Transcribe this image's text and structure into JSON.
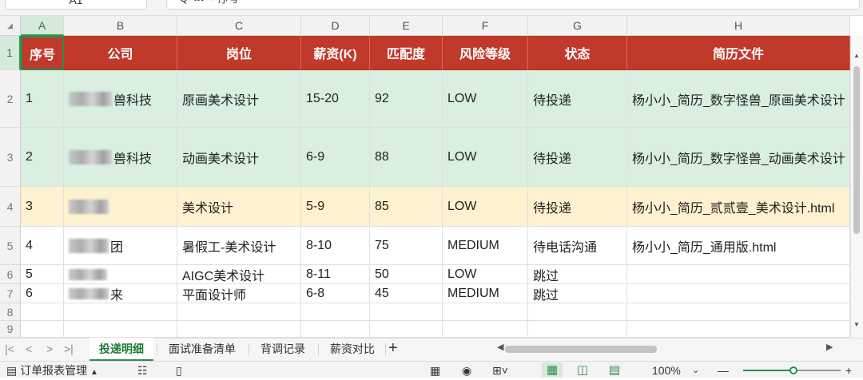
{
  "formula_bar": {
    "name_box": "A1",
    "zoom_icon": "Q",
    "fx_label": "fx",
    "value": "序号",
    "expand_icon": "chevron-down-icon"
  },
  "columns": [
    "A",
    "B",
    "C",
    "D",
    "E",
    "F",
    "G",
    "H"
  ],
  "header_row": {
    "row_number": "1",
    "cells": [
      "序号",
      "公司",
      "岗位",
      "薪资(K)",
      "匹配度",
      "风险等级",
      "状态",
      "简历文件"
    ]
  },
  "rows": [
    {
      "row_number": "2",
      "id": "1",
      "company_suffix": "兽科技",
      "position": "原画美术设计",
      "salary": "15-20",
      "match": "92",
      "risk": "LOW",
      "status": "待投递",
      "resume": "杨小小_简历_数字怪兽_原画美术设计"
    },
    {
      "row_number": "3",
      "id": "2",
      "company_suffix": "兽科技",
      "position": "动画美术设计",
      "salary": "6-9",
      "match": "88",
      "risk": "LOW",
      "status": "待投递",
      "resume": "杨小小_简历_数字怪兽_动画美术设计"
    },
    {
      "row_number": "4",
      "id": "3",
      "company_suffix": "",
      "position": "美术设计",
      "salary": "5-9",
      "match": "85",
      "risk": "LOW",
      "status": "待投递",
      "resume": "杨小小_简历_贰贰壹_美术设计.html"
    },
    {
      "row_number": "5",
      "id": "4",
      "company_suffix": "团",
      "position": "暑假工-美术设计",
      "salary": "8-10",
      "match": "75",
      "risk": "MEDIUM",
      "status": "待电话沟通",
      "resume": "杨小小_简历_通用版.html"
    },
    {
      "row_number": "6",
      "id": "5",
      "company_suffix": "",
      "position": "AIGC美术设计",
      "salary": "8-11",
      "match": "50",
      "risk": "LOW",
      "status": "跳过",
      "resume": ""
    },
    {
      "row_number": "7",
      "id": "6",
      "company_suffix": "来",
      "position": "平面设计师",
      "salary": "6-8",
      "match": "45",
      "risk": "MEDIUM",
      "status": "跳过",
      "resume": ""
    }
  ],
  "empty_rows": [
    "8",
    "9"
  ],
  "sheet_tabs": [
    "投递明细",
    "面试准备清单",
    "背调记录",
    "薪资对比"
  ],
  "add_tab": "+",
  "nav_buttons": [
    "|<",
    "<",
    ">",
    ">|"
  ],
  "status_bar": {
    "left_item": "订单报表管理",
    "zoom_level": "100%"
  },
  "colors": {
    "header_bg": "#c0392b",
    "low_risk_row": "#d9efe0",
    "pending_row": "#fdf1cf",
    "accent": "#2e8b4a"
  }
}
